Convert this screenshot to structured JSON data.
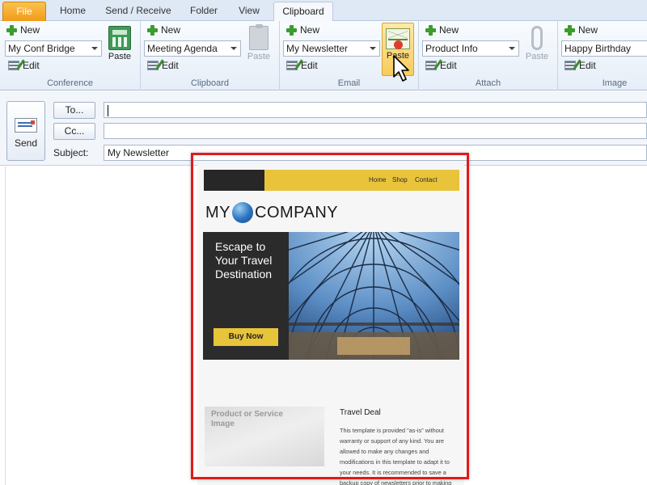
{
  "tabs": {
    "file": "File",
    "home": "Home",
    "send_receive": "Send / Receive",
    "folder": "Folder",
    "view": "View",
    "clipboard": "Clipboard"
  },
  "ribbon": {
    "groups": [
      {
        "label": "Conference",
        "new_label": "New",
        "combo_value": "My Conf Bridge",
        "edit_label": "Edit",
        "paste_label": "Paste",
        "paste_icon": "calculator-icon"
      },
      {
        "label": "Clipboard",
        "new_label": "New",
        "combo_value": "Meeting Agenda",
        "edit_label": "Edit",
        "paste_label": "Paste",
        "paste_icon": "clipboard-icon"
      },
      {
        "label": "Email",
        "new_label": "New",
        "combo_value": "My Newsletter",
        "edit_label": "Edit",
        "paste_label": "Paste",
        "paste_icon": "email-icon"
      },
      {
        "label": "Attach",
        "new_label": "New",
        "combo_value": "Product Info",
        "edit_label": "Edit",
        "paste_label": "Paste",
        "paste_icon": "paperclip-icon"
      },
      {
        "label": "Image",
        "new_label": "New",
        "combo_value": "Happy Birthday",
        "edit_label": "Edit"
      }
    ]
  },
  "compose": {
    "send_label": "Send",
    "to_label": "To...",
    "cc_label": "Cc...",
    "subject_label": "Subject:",
    "to_value": "",
    "cc_value": "",
    "subject_value": "My Newsletter"
  },
  "newsletter": {
    "nav": [
      "Home",
      "Shop",
      "Contact"
    ],
    "logo_left": "MY",
    "logo_right": "COMPANY",
    "hero_text": "Escape to Your Travel Destination",
    "buy_button": "Buy Now",
    "product_image_label": "Product or Service Image",
    "deal_title": "Travel Deal",
    "deal_text": "This template is provided \"as-is\" without warranty or support of any kind. You are allowed to make any changes and modifications in this template to adapt it to your needs.  It is recommended to save a backup copy of newsletters prior to making"
  },
  "colors": {
    "file_tab": "#f39b17",
    "accent_yellow": "#e9c43a",
    "highlight_box": "#e01b1b"
  }
}
